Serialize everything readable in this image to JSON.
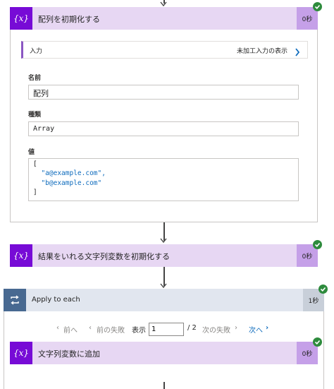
{
  "actions": [
    {
      "title": "配列を初期化する",
      "time": "0秒",
      "icon": "variable-icon"
    },
    {
      "title": "結果をいれる文字列変数を初期化する",
      "time": "0秒",
      "icon": "variable-icon"
    },
    {
      "title": "文字列変数に追加",
      "time": "0秒",
      "icon": "variable-icon"
    }
  ],
  "inputs": {
    "label": "入力",
    "raw_link": "未加工入力の表示",
    "name_label": "名前",
    "name_value": "配列",
    "type_label": "種類",
    "type_value": "Array",
    "value_label": "値",
    "value_lines": [
      "[",
      "  \"a@example.com\",",
      "  \"b@example.com\"",
      "]"
    ]
  },
  "loop": {
    "title": "Apply to each",
    "time": "1秒",
    "icon": "loop-icon"
  },
  "pager": {
    "first": "前へ",
    "prev_failed": "前の失敗",
    "show_label": "表示",
    "current": "1",
    "total": "/ 2",
    "next_failed": "次の失敗",
    "next": "次へ"
  },
  "colors": {
    "variable_icon": "#770bd6",
    "variable_header": "#e7d7f3",
    "loop_icon": "#486991",
    "success": "#2e8b3d",
    "link": "#0f6cbd"
  }
}
